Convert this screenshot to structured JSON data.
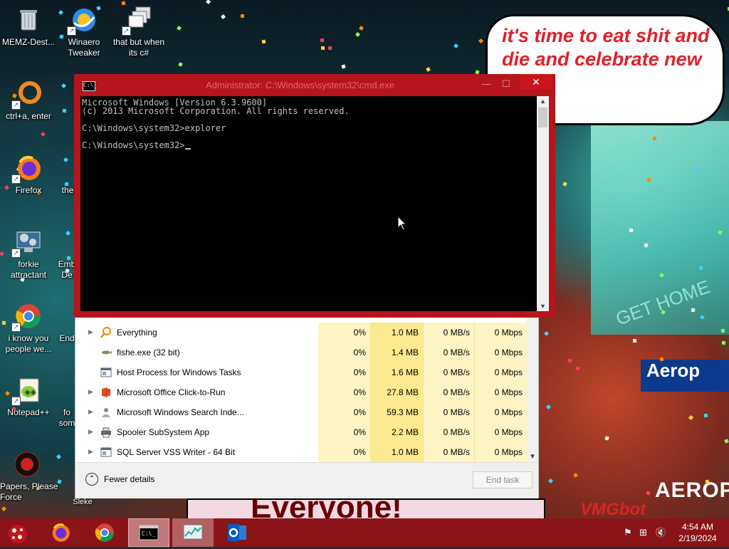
{
  "desktop": {
    "icons": [
      {
        "label": "MEMZ-Dest...",
        "icon": "recycle-bin-icon"
      },
      {
        "label": "Winaero\nTweaker",
        "icon": "winaero-icon"
      },
      {
        "label": "that but when\nits c#",
        "icon": "stacked-windows-icon"
      },
      {
        "label": "ctrl+a, enter",
        "icon": "ring-icon"
      },
      {
        "label": "Firefox",
        "icon": "firefox-icon"
      },
      {
        "label": "the",
        "icon": "document-icon"
      },
      {
        "label": "forkie\nattractant",
        "icon": "settings-monitor-icon"
      },
      {
        "label": "Emb\nDe",
        "icon": "app-icon"
      },
      {
        "label": "i know you\npeople we...",
        "icon": "chrome-icon"
      },
      {
        "label": "End",
        "icon": "app-icon"
      },
      {
        "label": "Notepad++",
        "icon": "notepadpp-icon"
      },
      {
        "label": "fo\nsom",
        "icon": "app-icon"
      },
      {
        "label": "Papers, Please Force",
        "icon": "papers-please-icon"
      },
      {
        "label": "Sleke",
        "icon": "app-icon"
      }
    ]
  },
  "wallpaper": {
    "speech_text": "it's time to eat shit and die and celebrate new year",
    "banner_text": "Everyone!",
    "watermark": "VMGbot",
    "neon_text": "GET HOME",
    "sign_text": "Aerop",
    "sign2_text": "AEROPOS"
  },
  "cmd": {
    "title": "Administrator: C:\\Windows\\system32\\cmd.exe",
    "min_label": "—",
    "max_label": "☐",
    "close_label": "✕",
    "lines": [
      "Microsoft Windows [Version 6.3.9600]",
      "(c) 2013 Microsoft Corporation. All rights reserved.",
      "",
      "C:\\Windows\\system32>explorer",
      "",
      "C:\\Windows\\system32>"
    ]
  },
  "taskmgr": {
    "processes": [
      {
        "name": "Everything",
        "expand": true,
        "icon": "magnifier-icon",
        "cpu": "0%",
        "memory": "1.0 MB",
        "disk": "0 MB/s",
        "network": "0 Mbps"
      },
      {
        "name": "fishe.exe (32 bit)",
        "expand": false,
        "icon": "fish-icon",
        "cpu": "0%",
        "memory": "1.4 MB",
        "disk": "0 MB/s",
        "network": "0 Mbps"
      },
      {
        "name": "Host Process for Windows Tasks",
        "expand": false,
        "icon": "window-process-icon",
        "cpu": "0%",
        "memory": "1.6 MB",
        "disk": "0 MB/s",
        "network": "0 Mbps"
      },
      {
        "name": "Microsoft Office Click-to-Run",
        "expand": true,
        "icon": "office-icon",
        "cpu": "0%",
        "memory": "27.8 MB",
        "disk": "0 MB/s",
        "network": "0 Mbps"
      },
      {
        "name": "Microsoft Windows Search Inde...",
        "expand": true,
        "icon": "search-indexer-icon",
        "cpu": "0%",
        "memory": "59.3 MB",
        "disk": "0 MB/s",
        "network": "0 Mbps"
      },
      {
        "name": "Spooler SubSystem App",
        "expand": true,
        "icon": "printer-icon",
        "cpu": "0%",
        "memory": "2.2 MB",
        "disk": "0 MB/s",
        "network": "0 Mbps"
      },
      {
        "name": "SQL Server VSS Writer - 64 Bit",
        "expand": true,
        "icon": "window-process-icon",
        "cpu": "0%",
        "memory": "1.0 MB",
        "disk": "0 MB/s",
        "network": "0 Mbps"
      }
    ],
    "fewer_details": "Fewer details",
    "end_task": "End task"
  },
  "taskbar": {
    "apps": [
      {
        "name": "firefox",
        "icon": "firefox-icon",
        "state": "pinned"
      },
      {
        "name": "chrome",
        "icon": "chrome-icon",
        "state": "pinned"
      },
      {
        "name": "command-prompt",
        "icon": "cmd-icon",
        "state": "active"
      },
      {
        "name": "task-manager",
        "icon": "task-manager-icon",
        "state": "open"
      },
      {
        "name": "outlook",
        "icon": "outlook-icon",
        "state": "pinned"
      }
    ],
    "time": "4:54 AM",
    "date": "2/19/2024"
  }
}
